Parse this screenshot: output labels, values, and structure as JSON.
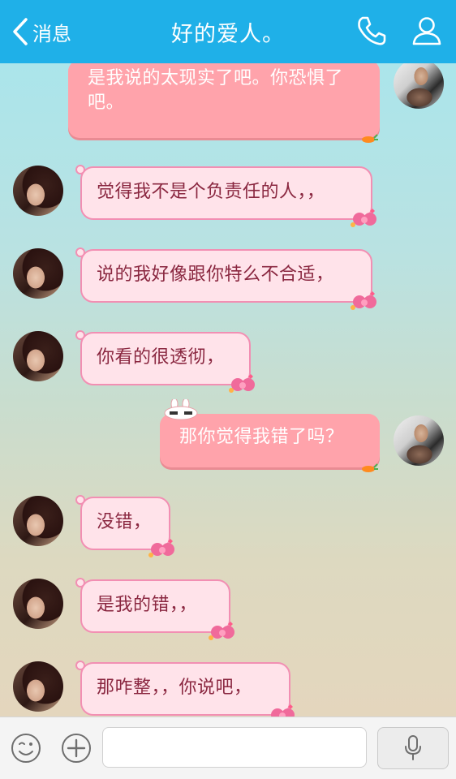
{
  "header": {
    "back_label": "消息",
    "title": "好的爱人。"
  },
  "messages": [
    {
      "side": "out",
      "text": "是我说的太现实了吧。你恐惧了吧。"
    },
    {
      "side": "in",
      "text": "觉得我不是个负责任的人，，"
    },
    {
      "side": "in",
      "text": "说的我好像跟你特么不合适，"
    },
    {
      "side": "in",
      "text": "你看的很透彻，"
    },
    {
      "side": "out",
      "text": "那你觉得我错了吗？"
    },
    {
      "side": "in",
      "text": "没错，"
    },
    {
      "side": "in",
      "text": "是我的错，，"
    },
    {
      "side": "in",
      "text": "那咋整，，你说吧，"
    }
  ],
  "input": {
    "placeholder": ""
  },
  "colors": {
    "header": "#1fb0e8",
    "incoming_bubble": "#ffe3ea",
    "incoming_border": "#f28fb3",
    "outgoing_bubble": "#ffa3ab",
    "incoming_text": "#8a2740"
  }
}
